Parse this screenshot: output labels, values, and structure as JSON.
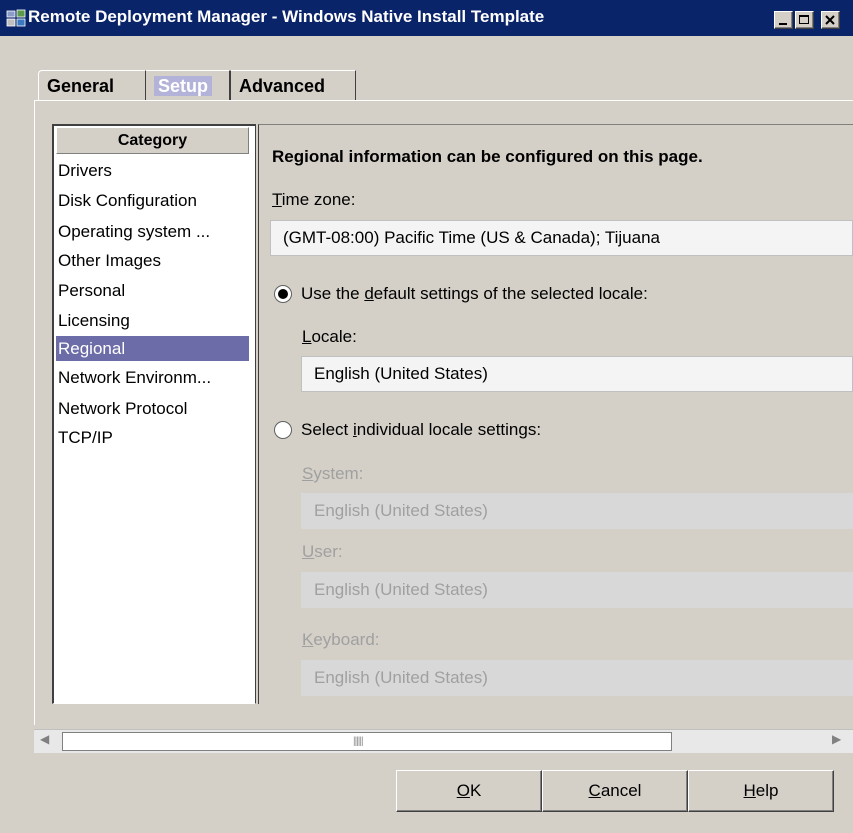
{
  "window": {
    "title": "Remote Deployment Manager - Windows Native Install Template",
    "icon": "app-icon",
    "controls": [
      "minimize-icon",
      "maximize-icon",
      "close-icon"
    ]
  },
  "tabs": [
    {
      "label": "General"
    },
    {
      "label": "Setup",
      "selected": true
    },
    {
      "label": "Advanced"
    }
  ],
  "sidebar": {
    "header": "Category",
    "items": [
      {
        "label": "Drivers"
      },
      {
        "label": "Disk Configuration"
      },
      {
        "label": "Operating system ..."
      },
      {
        "label": "Other Images"
      },
      {
        "label": "Personal"
      },
      {
        "label": "Licensing"
      },
      {
        "label": "Regional",
        "selected": true
      },
      {
        "label": "Network Environm..."
      },
      {
        "label": "Network Protocol"
      },
      {
        "label": "TCP/IP"
      }
    ]
  },
  "regional": {
    "heading": "Regional information can be configured on this page.",
    "timezone": {
      "label_u": "T",
      "label_rest": "ime zone:",
      "value": "(GMT-08:00) Pacific Time (US & Canada); Tijuana"
    },
    "default_option": {
      "pre": "Use the ",
      "u": "d",
      "post": "efault settings of the selected locale:",
      "checked": true
    },
    "locale": {
      "label_u": "L",
      "label_rest": "ocale:",
      "value": "English (United States)"
    },
    "individual_option": {
      "pre": "Select ",
      "u": "i",
      "post": "ndividual locale settings:",
      "checked": false
    },
    "system": {
      "label_u": "S",
      "label_rest": "ystem:",
      "value": "English (United States)"
    },
    "user": {
      "label_u": "U",
      "label_rest": "ser:",
      "value": "English (United States)"
    },
    "keyboard": {
      "label_u": "K",
      "label_rest": "eyboard:",
      "value": "English (United States)"
    }
  },
  "buttons": {
    "ok": {
      "u": "O",
      "rest": "K"
    },
    "cancel": {
      "u": "C",
      "rest": "ancel"
    },
    "help": {
      "u": "H",
      "rest": "elp"
    }
  },
  "colors": {
    "titlebar": "#0a246a",
    "selection": "#6c6ca8",
    "face": "#d4d0c8"
  }
}
